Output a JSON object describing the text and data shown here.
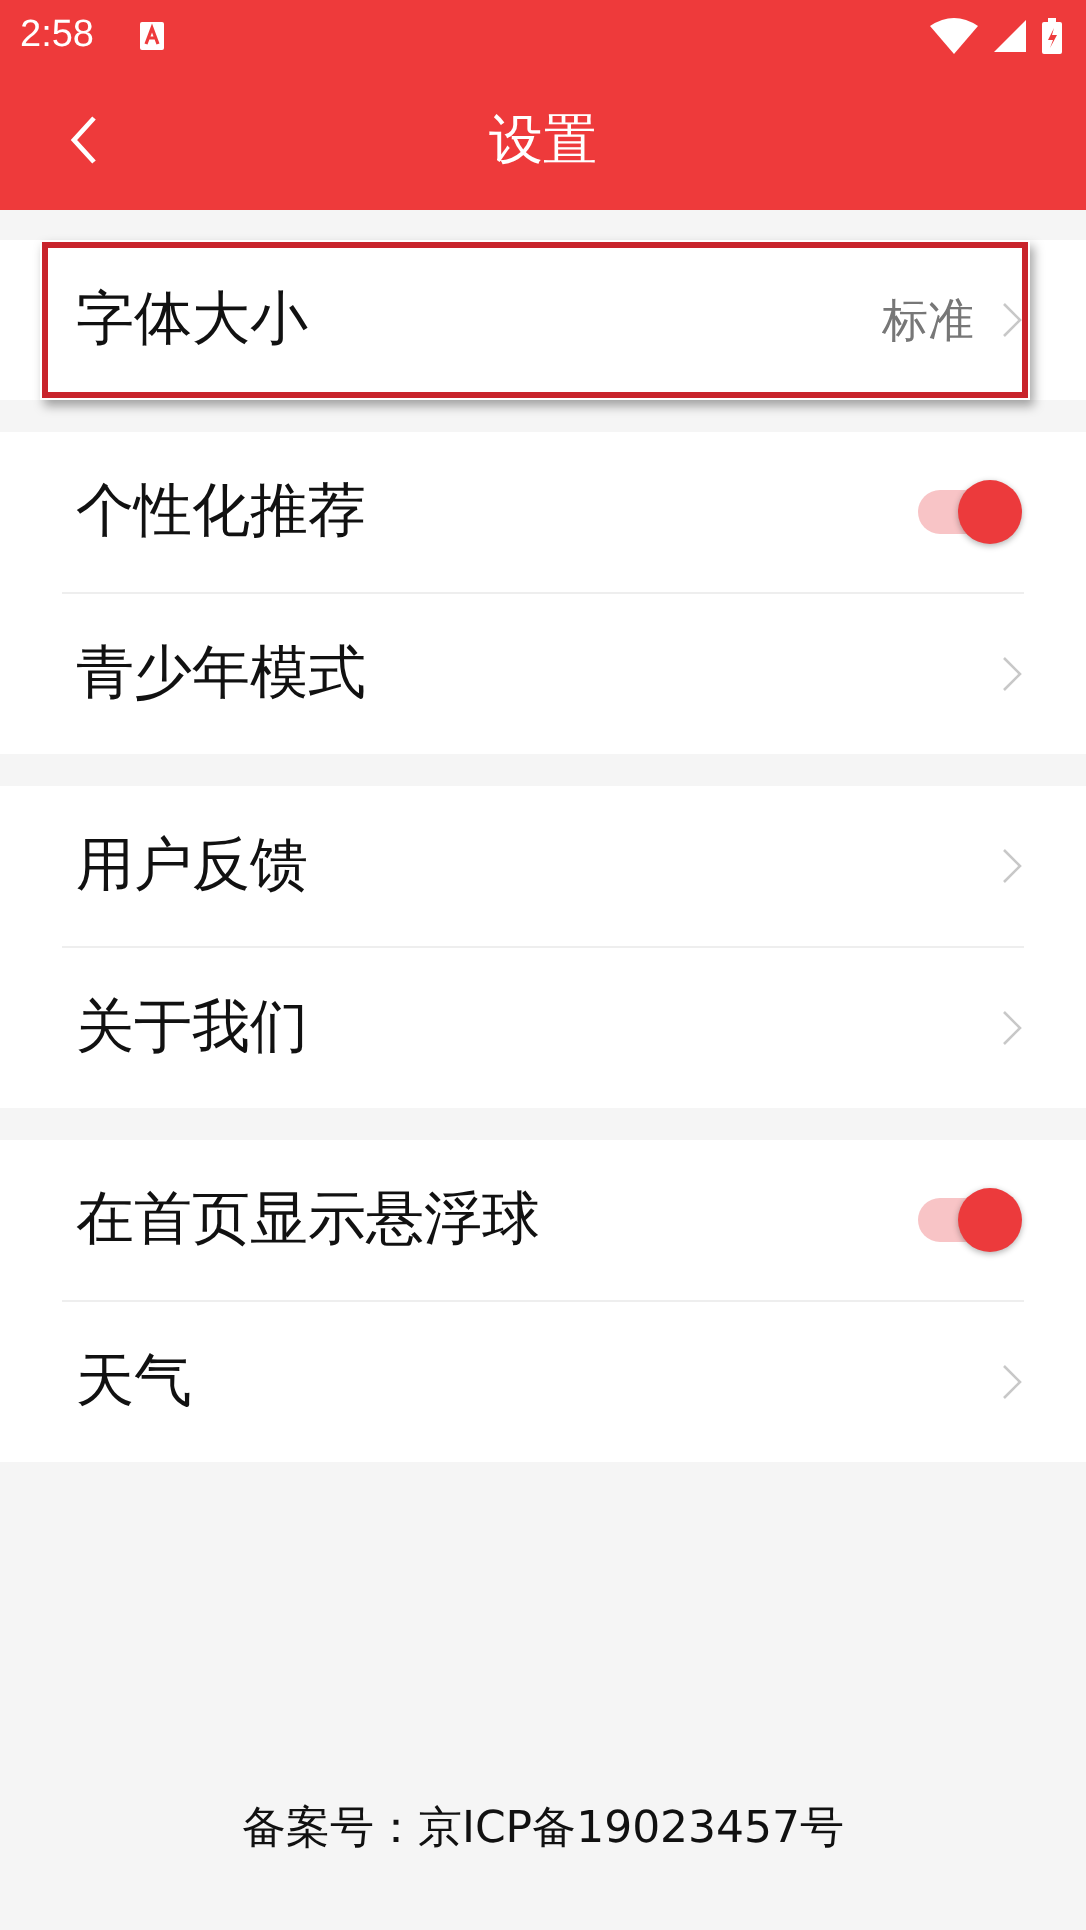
{
  "status_bar": {
    "time": "2:58"
  },
  "header": {
    "title": "设置"
  },
  "groups": [
    {
      "items": [
        {
          "kind": "link",
          "label": "字体大小",
          "value": "标准",
          "highlighted": true
        }
      ]
    },
    {
      "items": [
        {
          "kind": "toggle",
          "label": "个性化推荐",
          "on": true
        },
        {
          "kind": "link",
          "label": "青少年模式",
          "highlighted": false
        }
      ]
    },
    {
      "items": [
        {
          "kind": "link",
          "label": "用户反馈",
          "highlighted": false
        },
        {
          "kind": "link",
          "label": "关于我们",
          "highlighted": false
        }
      ]
    },
    {
      "items": [
        {
          "kind": "toggle",
          "label": "在首页显示悬浮球",
          "on": true
        },
        {
          "kind": "link",
          "label": "天气",
          "highlighted": false
        }
      ]
    }
  ],
  "footer": {
    "text": "备案号：京ICP备19023457号"
  }
}
